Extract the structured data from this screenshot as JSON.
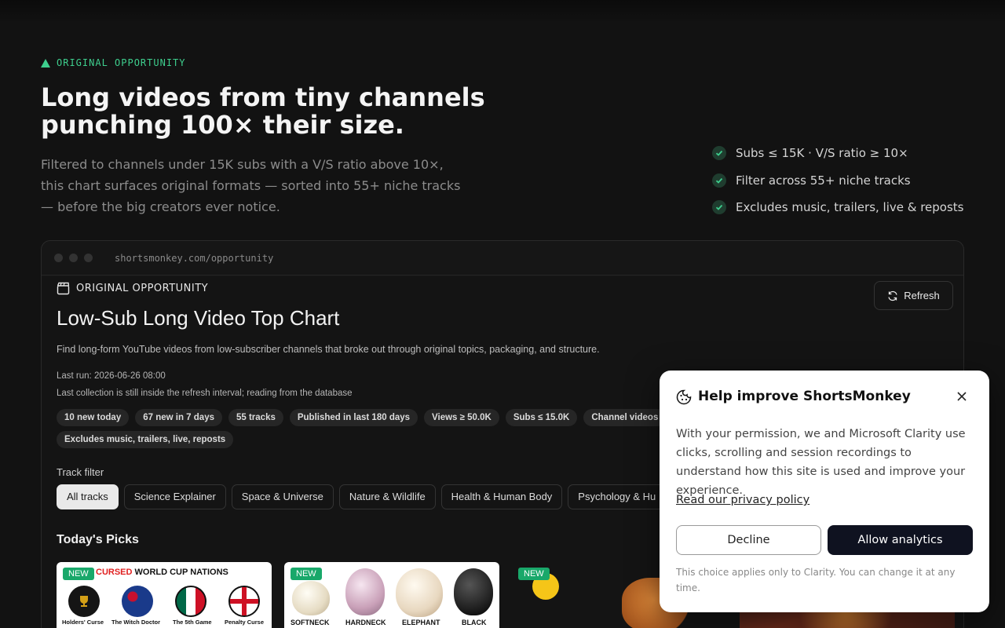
{
  "hero": {
    "eyebrow": "ORIGINAL OPPORTUNITY",
    "title": "Long videos from tiny channels punching 100× their size.",
    "subtitle": "Filtered to channels under 15K subs with a V/S ratio above 10×, this chart surfaces original formats — sorted into 55+ niche tracks — before the big creators ever notice.",
    "features": [
      "Subs ≤ 15K · V/S ratio ≥ 10×",
      "Filter across 55+ niche tracks",
      "Excludes music, trailers, live & reposts"
    ]
  },
  "browser": {
    "url": "shortsmonkey.com/opportunity"
  },
  "app": {
    "eyebrow": "ORIGINAL OPPORTUNITY",
    "title": "Low-Sub Long Video Top Chart",
    "description": "Find long-form YouTube videos from low-subscriber channels that broke out through original topics, packaging, and structure.",
    "last_run": "Last run: 2026-06-26 08:00",
    "collection_note": "Last collection is still inside the refresh interval; reading from the database",
    "refresh_label": "Refresh",
    "chips": [
      "10 new today",
      "67 new in 7 days",
      "55 tracks",
      "Published in last 180 days",
      "Views ≥ 50.0K",
      "Subs ≤ 15.0K",
      "Channel videos",
      "Excludes music, trailers, live, reposts"
    ],
    "track_filter_label": "Track filter",
    "tracks": [
      "All tracks",
      "Science Explainer",
      "Space & Universe",
      "Nature & Wildlife",
      "Health & Human Body",
      "Psychology & Hu"
    ],
    "picks_title": "Today's Picks",
    "new_badge": "NEW",
    "card1": {
      "title_red": "CURSED",
      "title_rest": " WORLD CUP NATIONS",
      "captions": [
        "Holders' Curse",
        "The Witch Doctor",
        "The 5th Game",
        "Penalty Curse"
      ]
    },
    "card2": {
      "captions": [
        "SOFTNECK",
        "HARDNECK",
        "ELEPHANT",
        "BLACK"
      ]
    }
  },
  "consent": {
    "title": "Help improve ShortsMonkey",
    "body": "With your permission, we and Microsoft Clarity use clicks, scrolling and session recordings to understand how this site is used and improve your experience.",
    "privacy_link": "Read our privacy policy",
    "decline": "Decline",
    "allow": "Allow analytics",
    "footnote": "This choice applies only to Clarity. You can change it at any time."
  },
  "colors": {
    "accent": "#3ecf8e",
    "new_badge": "#19a86a",
    "primary_button": "#0f1220"
  }
}
